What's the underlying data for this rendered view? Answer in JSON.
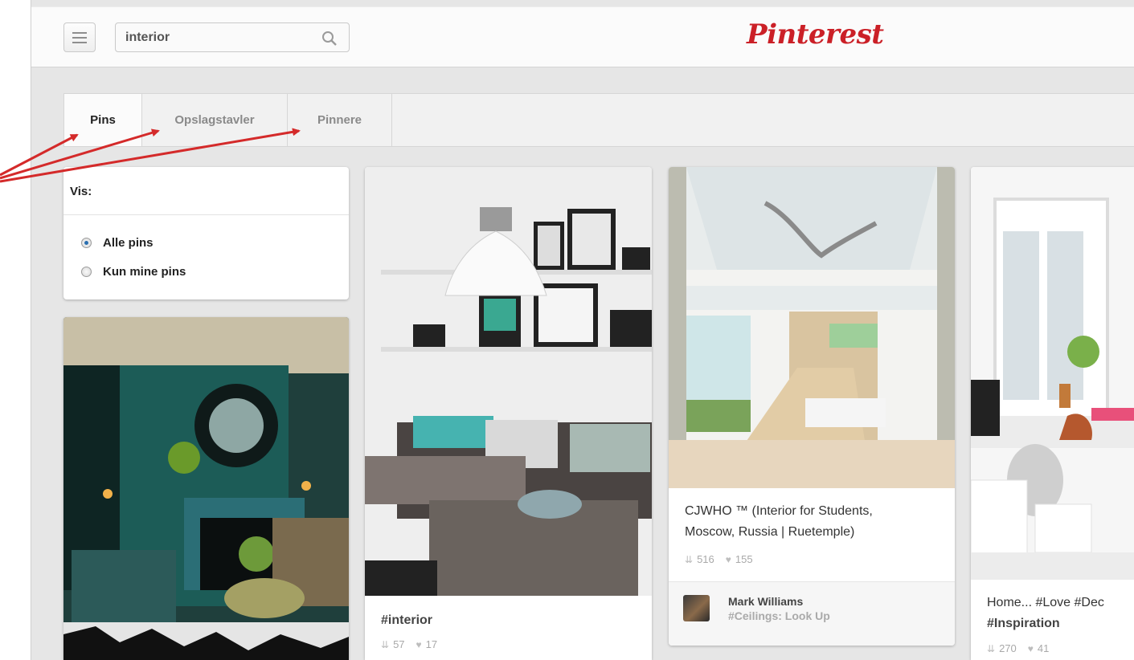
{
  "header": {
    "search": {
      "value": "interior",
      "icon": "search-icon"
    },
    "logo": "Pinterest",
    "menu_icon": "hamburger-icon",
    "brand_color": "#cb2027"
  },
  "tabs": [
    {
      "label": "Pins",
      "active": true
    },
    {
      "label": "Opslagstavler",
      "active": false
    },
    {
      "label": "Pinnere",
      "active": false
    }
  ],
  "filter": {
    "title": "Vis:",
    "options": [
      {
        "label": "Alle pins",
        "selected": true
      },
      {
        "label": "Kun mine pins",
        "selected": false
      }
    ]
  },
  "pins": [
    {
      "description": "#interior",
      "repins": "57",
      "likes": "17"
    },
    {
      "description": "CJWHO ™ (Interior for Students, Moscow, Russia | Ruetemple)",
      "line1": "CJWHO ™ (Interior for Students,",
      "line2": "Moscow, Russia | Ruetemple)",
      "repins": "516",
      "likes": "155",
      "pinner": {
        "name": "Mark Williams",
        "board": "#Ceilings: Look Up"
      }
    },
    {
      "line1": "Home... #Love #Dec",
      "line2": "#Inspiration",
      "repins": "270",
      "likes": "41"
    }
  ],
  "annotation": {
    "arrow_color": "#d42a2a"
  }
}
